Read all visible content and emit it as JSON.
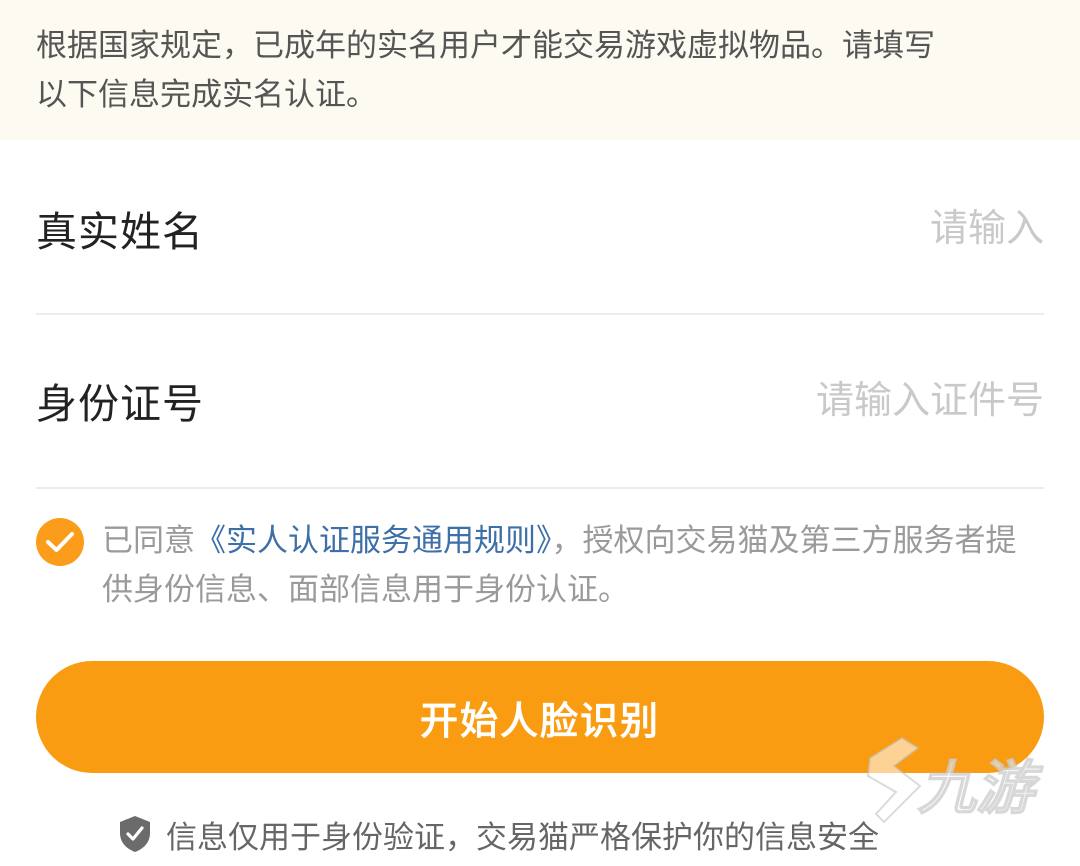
{
  "notice": {
    "line1": "根据国家规定，已成年的实名用户才能交易游戏虚拟物品。请填写",
    "line2": "以下信息完成实名认证。"
  },
  "form": {
    "name_label": "真实姓名",
    "name_placeholder": "请输入",
    "name_value": "",
    "id_label": "身份证号",
    "id_placeholder": "请输入证件号",
    "id_value": ""
  },
  "agreement": {
    "checked": true,
    "prefix": "已同意",
    "link": "《实人认证服务通用规则》",
    "suffix": "，授权向交易猫及第三方服务者提供身份信息、面部信息用于身份认证。"
  },
  "actions": {
    "start_label": "开始人脸识别"
  },
  "footer": {
    "text": "信息仅用于身份验证，交易猫严格保护你的信息安全"
  },
  "watermark": {
    "text": "九游"
  },
  "colors": {
    "accent": "#fa9c12",
    "link": "#3d6fa8",
    "notice_bg": "#fdfbf1"
  },
  "icons": {
    "checkbox": "check-circle-icon",
    "footer": "shield-check-icon"
  }
}
